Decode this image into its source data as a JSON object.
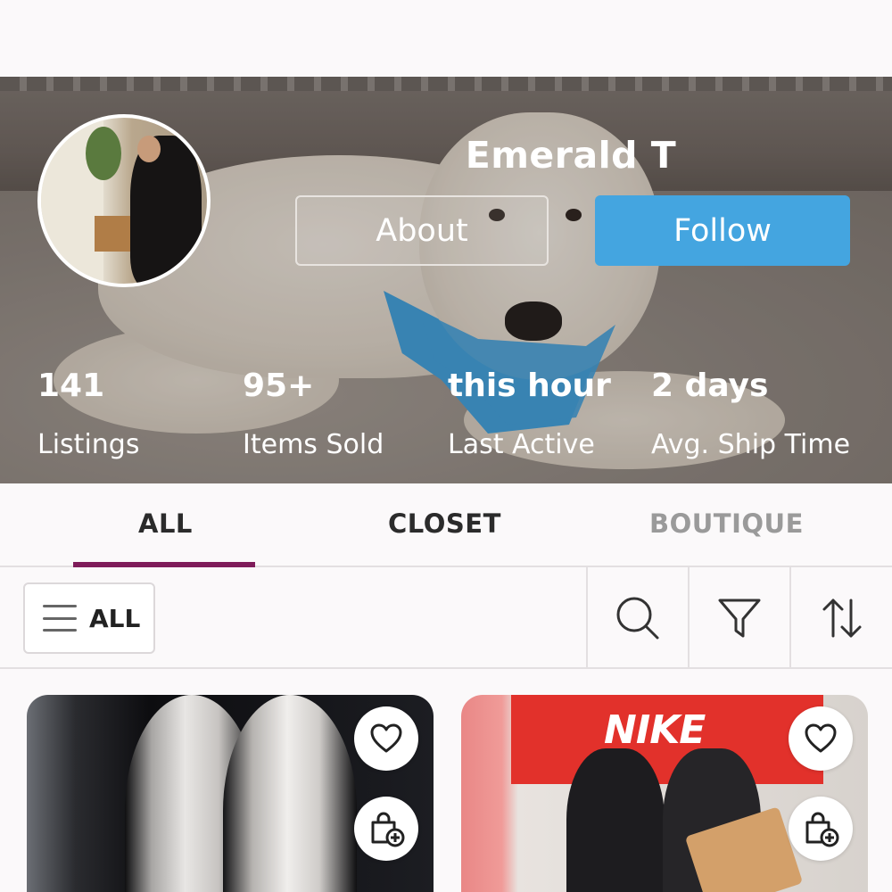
{
  "profile": {
    "name": "Emerald T",
    "about_label": "About",
    "follow_label": "Follow",
    "follow_color": "#44a5e0"
  },
  "stats": [
    {
      "value": "141",
      "label": "Listings"
    },
    {
      "value": "95+",
      "label": "Items Sold"
    },
    {
      "value": "this hour",
      "label": "Last Active"
    },
    {
      "value": "2 days",
      "label": "Avg. Ship Time"
    }
  ],
  "tabs": [
    {
      "label": "ALL",
      "active": true
    },
    {
      "label": "CLOSET",
      "active": false
    },
    {
      "label": "BOUTIQUE",
      "active": false
    }
  ],
  "tab_accent_color": "#7f1c5a",
  "filter": {
    "category_label": "ALL",
    "icons": [
      "search-icon",
      "filter-icon",
      "sort-icon"
    ]
  },
  "listings": [
    {
      "brand_text": "",
      "icons": [
        "heart-icon",
        "add-to-bundle-icon"
      ]
    },
    {
      "brand_text": "NIKE",
      "icons": [
        "heart-icon",
        "add-to-bundle-icon"
      ]
    }
  ]
}
